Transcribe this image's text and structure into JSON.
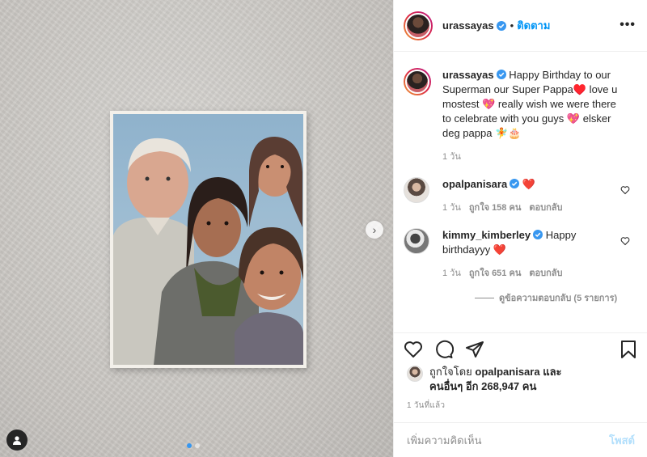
{
  "post": {
    "username": "urassayas",
    "follow_label": "ติดตาม",
    "separator": "•",
    "more_label": "•••"
  },
  "caption": {
    "username": "urassayas",
    "text": "Happy Birthday to our Superman our Super Pappa♥️ love u mostest 💖 really wish we were there to celebrate with you guys 💖 elsker deg pappa 🧚🎂",
    "time": "1 วัน"
  },
  "comments": [
    {
      "username": "opalpanisara",
      "text": "❤️",
      "time": "1 วัน",
      "likes": "ถูกใจ 158 คน",
      "reply": "ตอบกลับ"
    },
    {
      "username": "kimmy_kimberley",
      "text": "Happy birthdayyy ❤️",
      "time": "1 วัน",
      "likes": "ถูกใจ 651 คน",
      "reply": "ตอบกลับ"
    }
  ],
  "view_replies": "ดูข้อความตอบกลับ (5 รายการ)",
  "likes": {
    "prefix": "ถูกใจโดย",
    "user": "opalpanisara",
    "and": "และ",
    "others": "คนอื่นๆ อีก 268,947 คน"
  },
  "posted_time": "1 วันที่แล้ว",
  "add_comment": {
    "placeholder": "เพิ่มความคิดเห็น",
    "post_label": "โพสต์"
  },
  "carousel": {
    "total": 2,
    "active": 1
  },
  "colors": {
    "link": "#0095f6",
    "verified": "#3897f0",
    "heart": "#ed4956",
    "muted": "#8e8e8e"
  }
}
